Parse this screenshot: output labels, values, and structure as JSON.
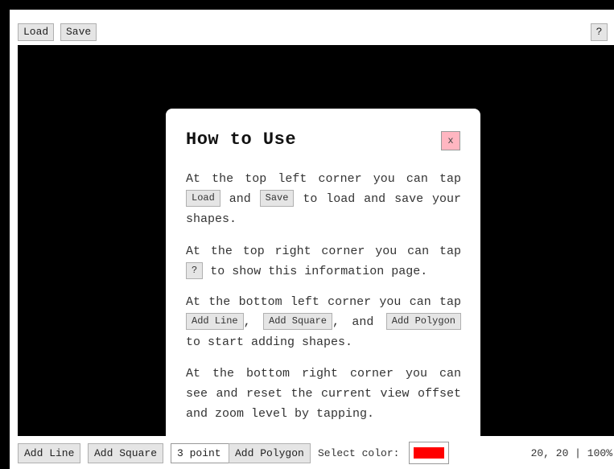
{
  "topbar": {
    "load_label": "Load",
    "save_label": "Save",
    "help_label": "?"
  },
  "modal": {
    "title": "How to Use",
    "close_label": "x",
    "p1": {
      "text_a": "At the top left corner you can tap",
      "btn_load": "Load",
      "text_b": "and",
      "btn_save": "Save",
      "text_c": "to load and save your shapes."
    },
    "p2": {
      "text_a": "At the top right corner you can tap",
      "btn_help": "?",
      "text_b": "to show this information page."
    },
    "p3": {
      "text_a": "At the bottom left corner you can tap",
      "btn_line": "Add Line",
      "text_b": ",",
      "btn_square": "Add Square",
      "text_c": ", and",
      "btn_polygon": "Add Polygon",
      "text_d": "to start adding shapes."
    },
    "p4": {
      "text": "At the bottom right corner you can see and reset the current view offset and zoom level by tapping."
    }
  },
  "bottombar": {
    "add_line_label": "Add Line",
    "add_square_label": "Add Square",
    "points_value": "3 point",
    "add_polygon_label": "Add Polygon",
    "select_color_label": "Select color:",
    "selected_color": "#ff0000",
    "view_readout": "20, 20 | 100%"
  },
  "colors": {
    "canvas_bg": "#000000",
    "close_button_bg": "#ffb6c1",
    "button_bg": "#e5e5e5"
  },
  "icons": {
    "help": "question-mark-icon",
    "close": "close-icon"
  }
}
